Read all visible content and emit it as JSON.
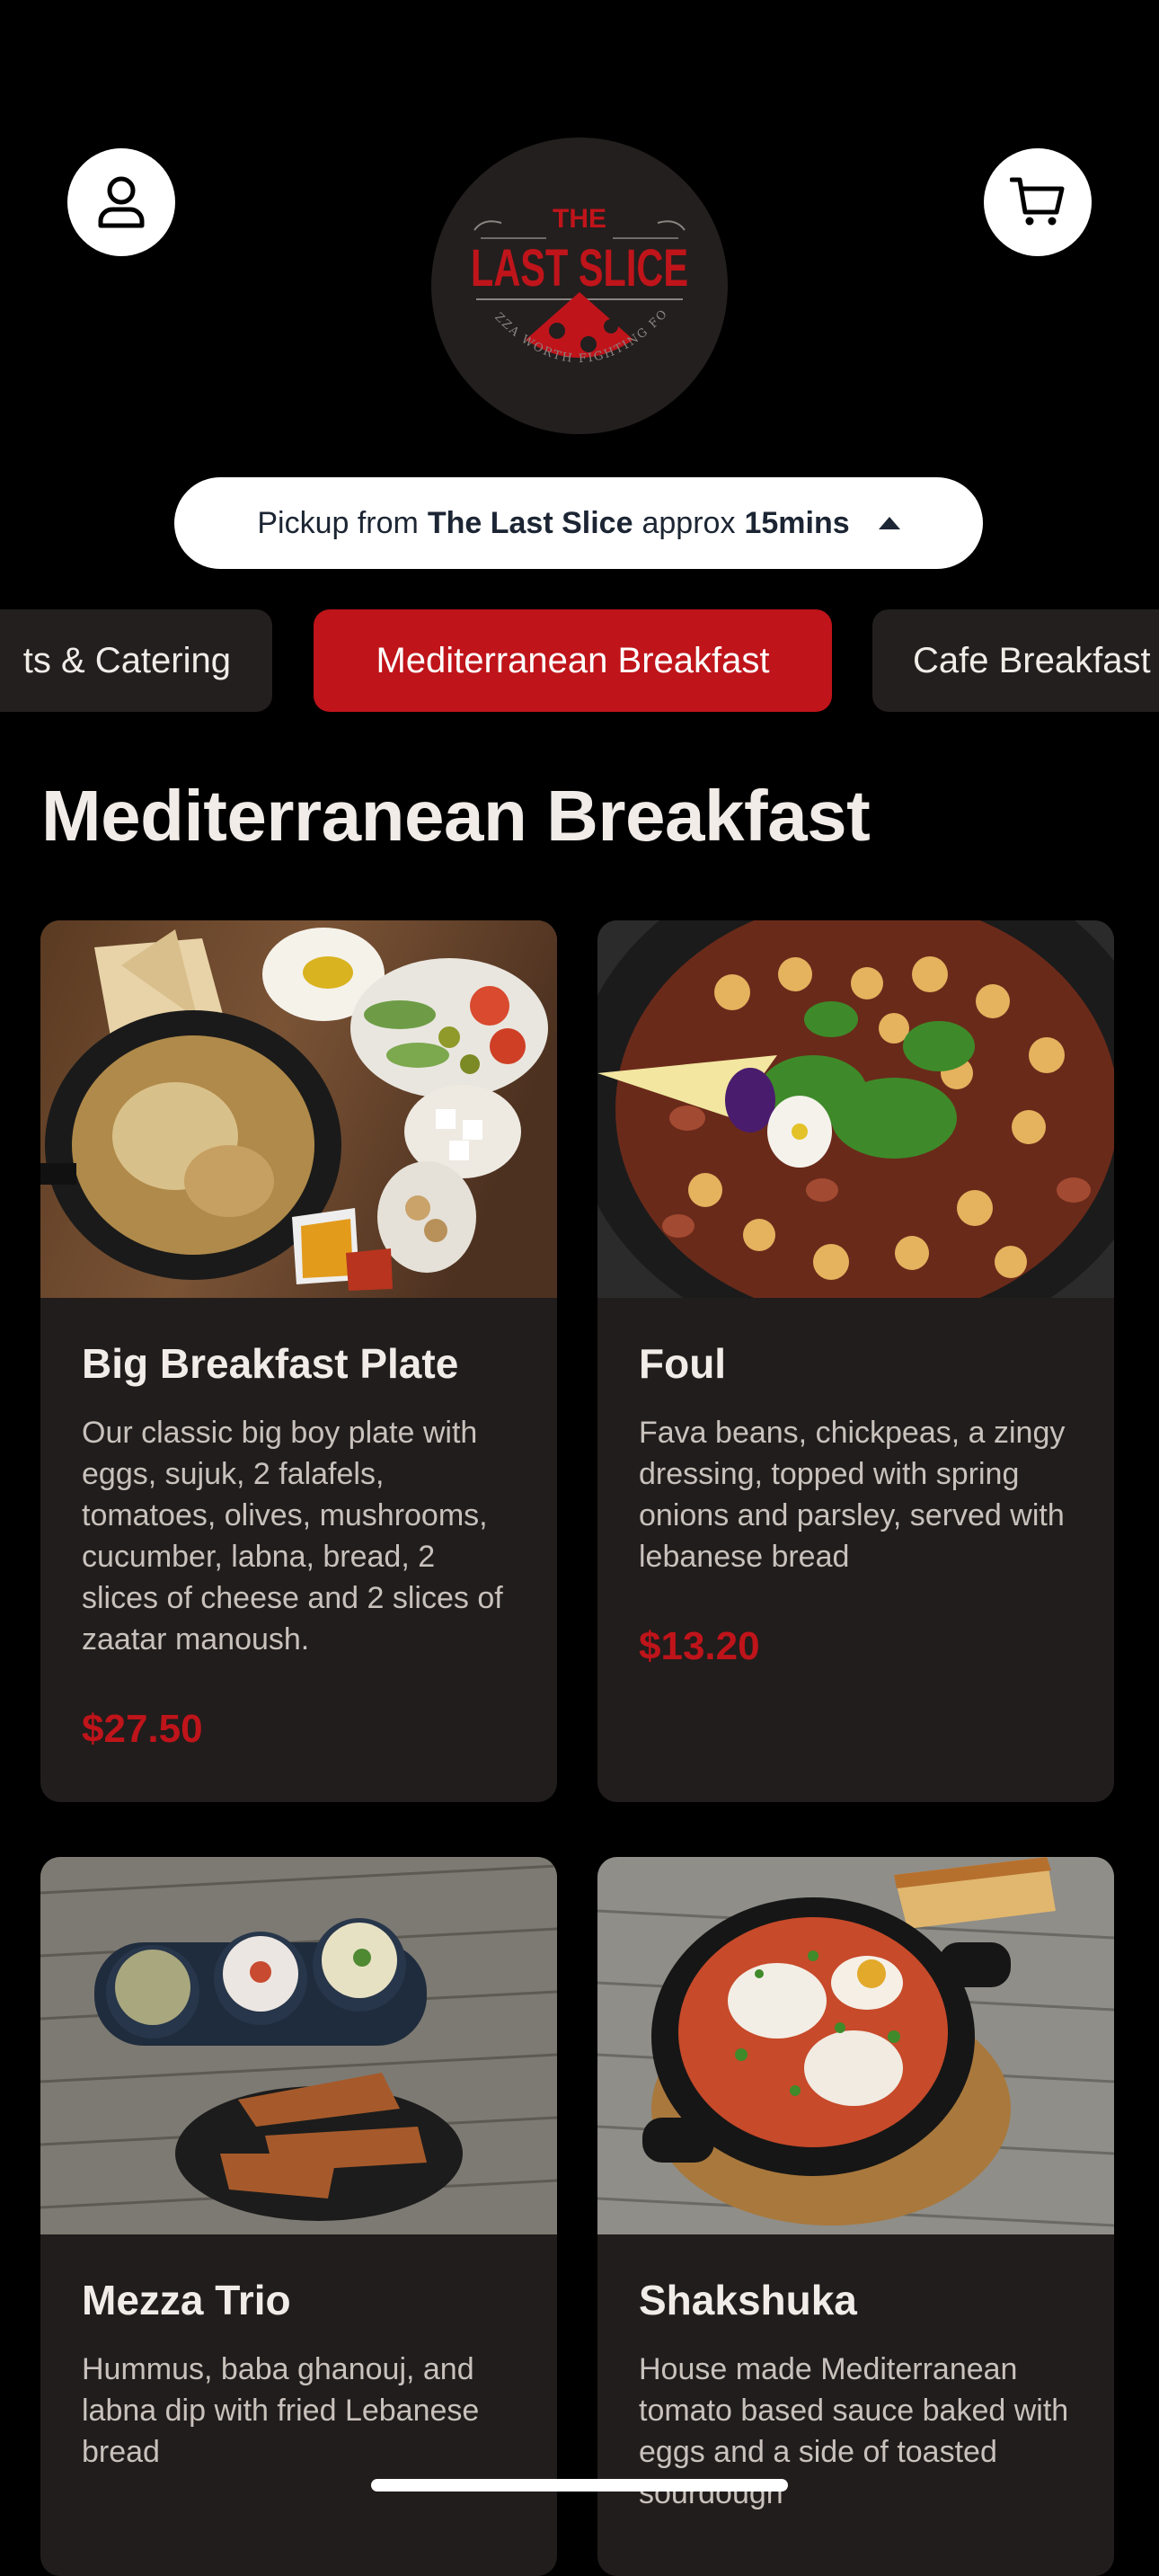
{
  "header": {
    "account_icon": "user-icon",
    "cart_icon": "shopping-cart-icon",
    "logo": {
      "text_top": "THE",
      "text_main": "LAST SLICE",
      "tagline": "PIZZA WORTH FIGHTING FOR"
    }
  },
  "pickup": {
    "prefix": "Pickup from",
    "store": "The Last Slice",
    "middle": "approx",
    "time": "15mins",
    "icon": "caret-up-icon"
  },
  "tabs": [
    {
      "label": "ts & Catering",
      "active": false
    },
    {
      "label": "Mediterranean Breakfast",
      "active": true
    },
    {
      "label": "Cafe Breakfast",
      "active": false
    }
  ],
  "section": {
    "title": "Mediterranean Breakfast"
  },
  "items": [
    {
      "name": "Big Breakfast Plate",
      "description": "Our classic big boy plate with eggs, sujuk, 2 falafels, tomatoes, olives, mushrooms, cucumber, labna, bread, 2 slices of cheese and 2 slices of zaatar manoush.",
      "price": "$27.50"
    },
    {
      "name": "Foul",
      "description": "Fava beans, chickpeas, a zingy dressing, topped with spring onions and parsley, served with lebanese bread",
      "price": "$13.20"
    },
    {
      "name": "Mezza Trio",
      "description": "Hummus, baba ghanouj, and labna dip with fried Lebanese bread",
      "price": ""
    },
    {
      "name": "Shakshuka",
      "description": "House made Mediterranean tomato based sauce baked with eggs and a side of toasted sourdough",
      "price": ""
    }
  ],
  "colors": {
    "background": "#000000",
    "card": "#211d1c",
    "accent_red": "#bf141a",
    "text_light": "#f1ece8"
  }
}
